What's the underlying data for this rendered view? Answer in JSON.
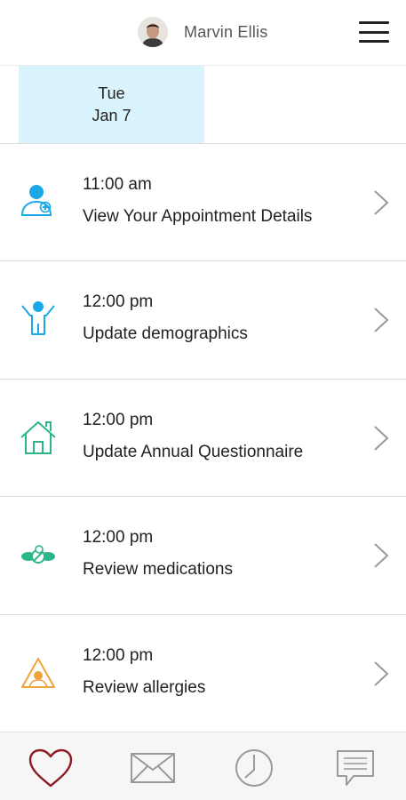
{
  "header": {
    "user_name": "Marvin Ellis",
    "avatar_icon": "user-avatar",
    "menu_icon": "hamburger-menu-icon"
  },
  "date_tabs": [
    {
      "day": "Tue",
      "date": "Jan 7",
      "selected": true
    }
  ],
  "colors": {
    "selected_date_bg": "#d9f4fd",
    "doctor_icon": "#1aa8e8",
    "person_icon": "#1aa8e8",
    "house_icon": "#2bb58a",
    "pills_icon": "#2bb58a",
    "allergy_icon": "#f0a33a",
    "heart_icon": "#8b1a24",
    "tab_icon_inactive": "#9a9a9a"
  },
  "tasks": [
    {
      "time": "11:00 am",
      "title": "View Your Appointment Details",
      "icon": "doctor-icon"
    },
    {
      "time": "12:00 pm",
      "title": "Update demographics",
      "icon": "person-icon"
    },
    {
      "time": "12:00 pm",
      "title": "Update Annual Questionnaire",
      "icon": "house-icon"
    },
    {
      "time": "12:00 pm",
      "title": "Review medications",
      "icon": "pills-icon"
    },
    {
      "time": "12:00 pm",
      "title": "Review allergies",
      "icon": "allergy-warning-icon"
    }
  ],
  "tabbar": {
    "tabs": [
      {
        "icon": "heart-icon",
        "active": true
      },
      {
        "icon": "mail-icon",
        "active": false
      },
      {
        "icon": "clock-icon",
        "active": false
      },
      {
        "icon": "chat-icon",
        "active": false
      }
    ]
  }
}
